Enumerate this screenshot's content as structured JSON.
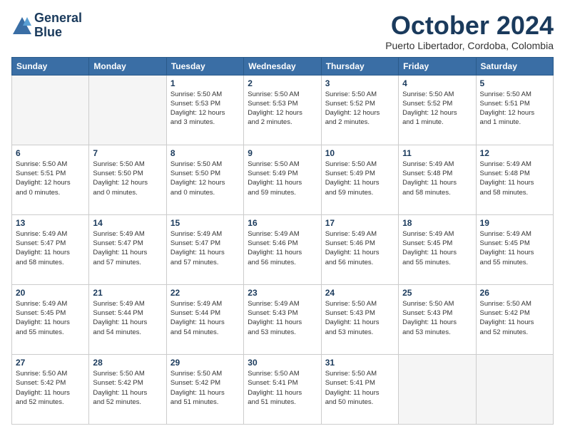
{
  "header": {
    "logo_line1": "General",
    "logo_line2": "Blue",
    "month": "October 2024",
    "location": "Puerto Libertador, Cordoba, Colombia"
  },
  "weekdays": [
    "Sunday",
    "Monday",
    "Tuesday",
    "Wednesday",
    "Thursday",
    "Friday",
    "Saturday"
  ],
  "weeks": [
    [
      {
        "day": "",
        "info": ""
      },
      {
        "day": "",
        "info": ""
      },
      {
        "day": "1",
        "info": "Sunrise: 5:50 AM\nSunset: 5:53 PM\nDaylight: 12 hours\nand 3 minutes."
      },
      {
        "day": "2",
        "info": "Sunrise: 5:50 AM\nSunset: 5:53 PM\nDaylight: 12 hours\nand 2 minutes."
      },
      {
        "day": "3",
        "info": "Sunrise: 5:50 AM\nSunset: 5:52 PM\nDaylight: 12 hours\nand 2 minutes."
      },
      {
        "day": "4",
        "info": "Sunrise: 5:50 AM\nSunset: 5:52 PM\nDaylight: 12 hours\nand 1 minute."
      },
      {
        "day": "5",
        "info": "Sunrise: 5:50 AM\nSunset: 5:51 PM\nDaylight: 12 hours\nand 1 minute."
      }
    ],
    [
      {
        "day": "6",
        "info": "Sunrise: 5:50 AM\nSunset: 5:51 PM\nDaylight: 12 hours\nand 0 minutes."
      },
      {
        "day": "7",
        "info": "Sunrise: 5:50 AM\nSunset: 5:50 PM\nDaylight: 12 hours\nand 0 minutes."
      },
      {
        "day": "8",
        "info": "Sunrise: 5:50 AM\nSunset: 5:50 PM\nDaylight: 12 hours\nand 0 minutes."
      },
      {
        "day": "9",
        "info": "Sunrise: 5:50 AM\nSunset: 5:49 PM\nDaylight: 11 hours\nand 59 minutes."
      },
      {
        "day": "10",
        "info": "Sunrise: 5:50 AM\nSunset: 5:49 PM\nDaylight: 11 hours\nand 59 minutes."
      },
      {
        "day": "11",
        "info": "Sunrise: 5:49 AM\nSunset: 5:48 PM\nDaylight: 11 hours\nand 58 minutes."
      },
      {
        "day": "12",
        "info": "Sunrise: 5:49 AM\nSunset: 5:48 PM\nDaylight: 11 hours\nand 58 minutes."
      }
    ],
    [
      {
        "day": "13",
        "info": "Sunrise: 5:49 AM\nSunset: 5:47 PM\nDaylight: 11 hours\nand 58 minutes."
      },
      {
        "day": "14",
        "info": "Sunrise: 5:49 AM\nSunset: 5:47 PM\nDaylight: 11 hours\nand 57 minutes."
      },
      {
        "day": "15",
        "info": "Sunrise: 5:49 AM\nSunset: 5:47 PM\nDaylight: 11 hours\nand 57 minutes."
      },
      {
        "day": "16",
        "info": "Sunrise: 5:49 AM\nSunset: 5:46 PM\nDaylight: 11 hours\nand 56 minutes."
      },
      {
        "day": "17",
        "info": "Sunrise: 5:49 AM\nSunset: 5:46 PM\nDaylight: 11 hours\nand 56 minutes."
      },
      {
        "day": "18",
        "info": "Sunrise: 5:49 AM\nSunset: 5:45 PM\nDaylight: 11 hours\nand 55 minutes."
      },
      {
        "day": "19",
        "info": "Sunrise: 5:49 AM\nSunset: 5:45 PM\nDaylight: 11 hours\nand 55 minutes."
      }
    ],
    [
      {
        "day": "20",
        "info": "Sunrise: 5:49 AM\nSunset: 5:45 PM\nDaylight: 11 hours\nand 55 minutes."
      },
      {
        "day": "21",
        "info": "Sunrise: 5:49 AM\nSunset: 5:44 PM\nDaylight: 11 hours\nand 54 minutes."
      },
      {
        "day": "22",
        "info": "Sunrise: 5:49 AM\nSunset: 5:44 PM\nDaylight: 11 hours\nand 54 minutes."
      },
      {
        "day": "23",
        "info": "Sunrise: 5:49 AM\nSunset: 5:43 PM\nDaylight: 11 hours\nand 53 minutes."
      },
      {
        "day": "24",
        "info": "Sunrise: 5:50 AM\nSunset: 5:43 PM\nDaylight: 11 hours\nand 53 minutes."
      },
      {
        "day": "25",
        "info": "Sunrise: 5:50 AM\nSunset: 5:43 PM\nDaylight: 11 hours\nand 53 minutes."
      },
      {
        "day": "26",
        "info": "Sunrise: 5:50 AM\nSunset: 5:42 PM\nDaylight: 11 hours\nand 52 minutes."
      }
    ],
    [
      {
        "day": "27",
        "info": "Sunrise: 5:50 AM\nSunset: 5:42 PM\nDaylight: 11 hours\nand 52 minutes."
      },
      {
        "day": "28",
        "info": "Sunrise: 5:50 AM\nSunset: 5:42 PM\nDaylight: 11 hours\nand 52 minutes."
      },
      {
        "day": "29",
        "info": "Sunrise: 5:50 AM\nSunset: 5:42 PM\nDaylight: 11 hours\nand 51 minutes."
      },
      {
        "day": "30",
        "info": "Sunrise: 5:50 AM\nSunset: 5:41 PM\nDaylight: 11 hours\nand 51 minutes."
      },
      {
        "day": "31",
        "info": "Sunrise: 5:50 AM\nSunset: 5:41 PM\nDaylight: 11 hours\nand 50 minutes."
      },
      {
        "day": "",
        "info": ""
      },
      {
        "day": "",
        "info": ""
      }
    ]
  ]
}
